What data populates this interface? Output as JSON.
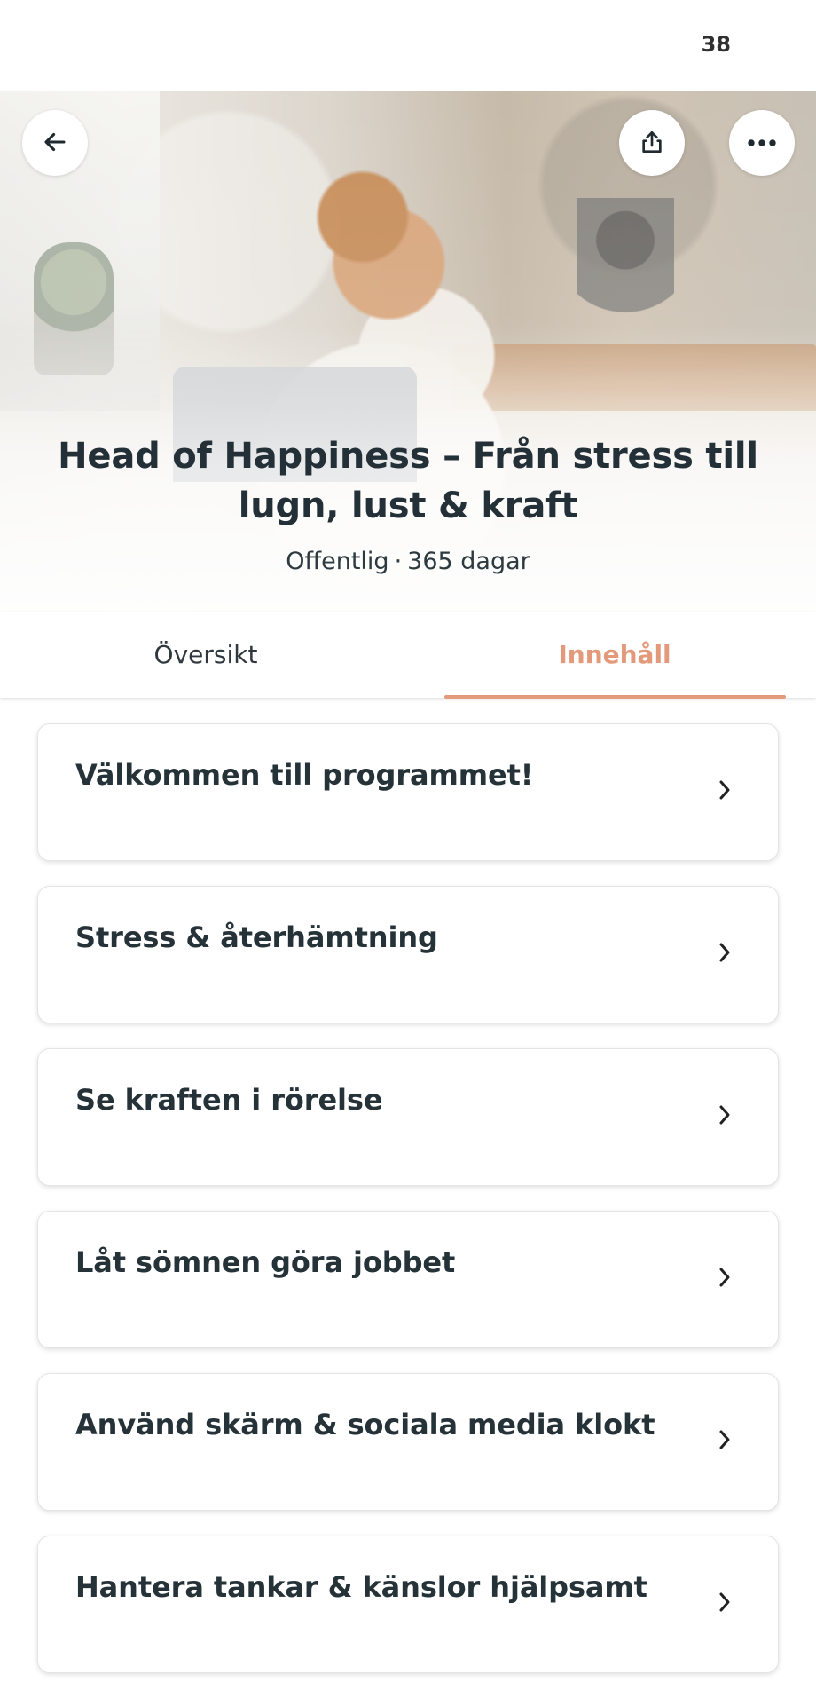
{
  "status_bar": {
    "indicator": "38"
  },
  "hero": {
    "title": "Head of Happiness – Från stress till lugn, lust & kraft",
    "visibility": "Offentlig",
    "separator": "·",
    "duration": "365 dagar"
  },
  "header_actions": {
    "back_icon": "arrow-left-icon",
    "share_icon": "share-icon",
    "more_icon": "more-dots-icon"
  },
  "tabs": [
    {
      "label": "Översikt",
      "active": false
    },
    {
      "label": "Innehåll",
      "active": true
    }
  ],
  "modules": [
    {
      "title": "Välkommen till programmet!",
      "icon": "chevron-right-icon"
    },
    {
      "title": "Stress & återhämtning",
      "icon": "chevron-right-icon"
    },
    {
      "title": "Se kraften i rörelse",
      "icon": "chevron-right-icon"
    },
    {
      "title": "Låt sömnen göra jobbet",
      "icon": "chevron-right-icon"
    },
    {
      "title": "Använd skärm & sociala media klokt",
      "icon": "chevron-right-icon"
    },
    {
      "title": "Hantera tankar & känslor hjälpsamt",
      "icon": "chevron-right-icon"
    }
  ],
  "colors": {
    "accent": "#E39A7B",
    "text_primary": "#243038",
    "card_border": "#E2E4E6"
  }
}
